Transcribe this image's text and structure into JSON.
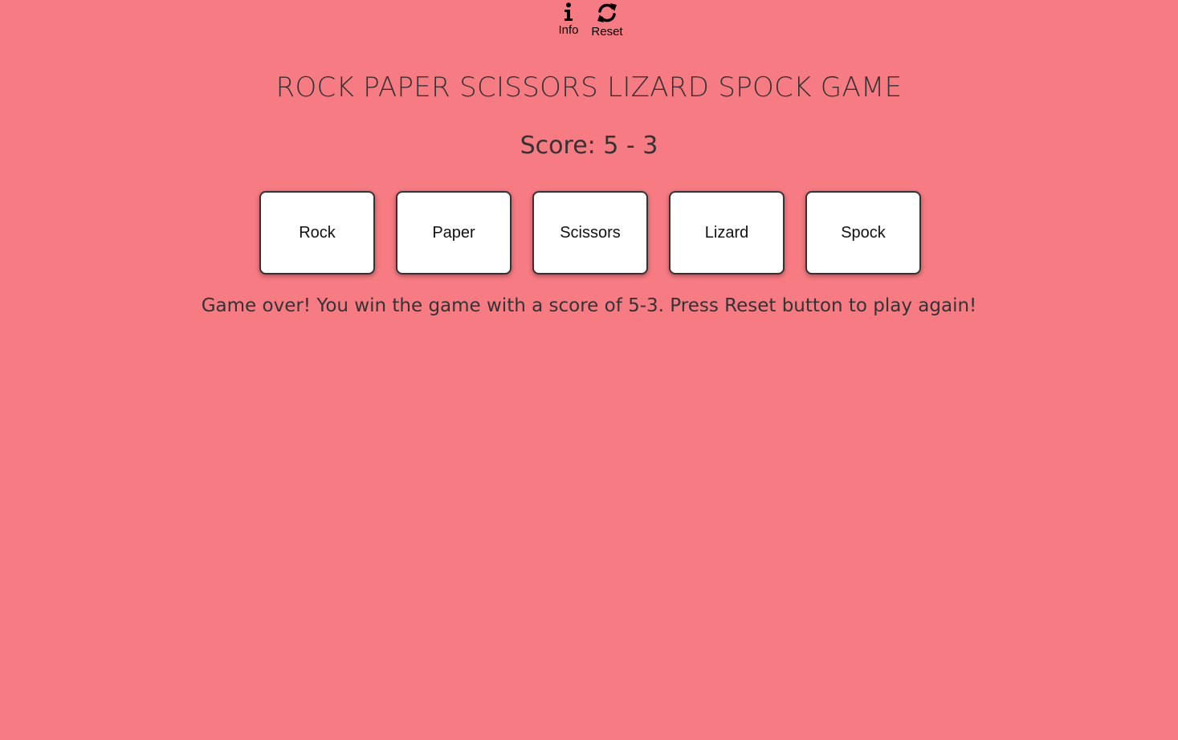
{
  "header": {
    "info_label": "Info",
    "info_icon": "info-icon",
    "reset_label": "Reset",
    "reset_icon": "refresh-icon"
  },
  "title": "ROCK PAPER SCISSORS LIZARD SPOCK GAME",
  "score_text": "Score: 5 - 3",
  "choices": [
    {
      "label": "Rock"
    },
    {
      "label": "Paper"
    },
    {
      "label": "Scissors"
    },
    {
      "label": "Lizard"
    },
    {
      "label": "Spock"
    }
  ],
  "message": "Game over! You win the game with a score of 5-3. Press Reset button to play again!",
  "colors": {
    "background": "#f77b83",
    "button_bg": "#ffffff",
    "text": "#333333"
  }
}
